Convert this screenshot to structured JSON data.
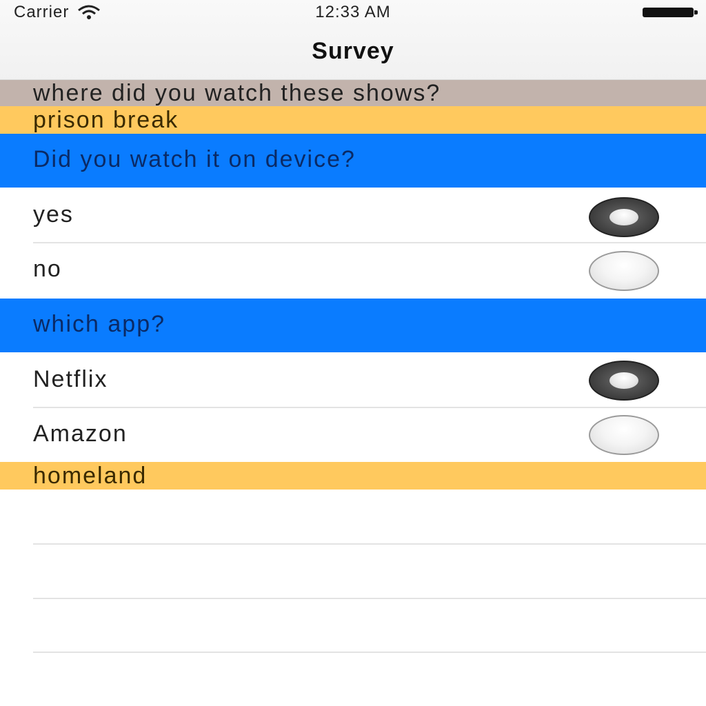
{
  "status_bar": {
    "carrier": "Carrier",
    "time": "12:33 AM",
    "wifi_icon": "wifi-icon",
    "battery_icon": "battery-icon"
  },
  "nav": {
    "title": "Survey"
  },
  "survey": {
    "section_title": "where did you watch these shows?",
    "shows": [
      {
        "name": "prison break",
        "questions": [
          {
            "text": "Did you watch it on device?",
            "options": [
              {
                "label": "yes",
                "selected": true
              },
              {
                "label": "no",
                "selected": false
              }
            ]
          },
          {
            "text": "which app?",
            "options": [
              {
                "label": "Netflix",
                "selected": true
              },
              {
                "label": "Amazon",
                "selected": false
              }
            ]
          }
        ]
      },
      {
        "name": "homeland",
        "questions": []
      }
    ]
  },
  "colors": {
    "section_header": "#c2b3ac",
    "show_header": "#ffc95e",
    "question_header": "#0a7cff"
  }
}
